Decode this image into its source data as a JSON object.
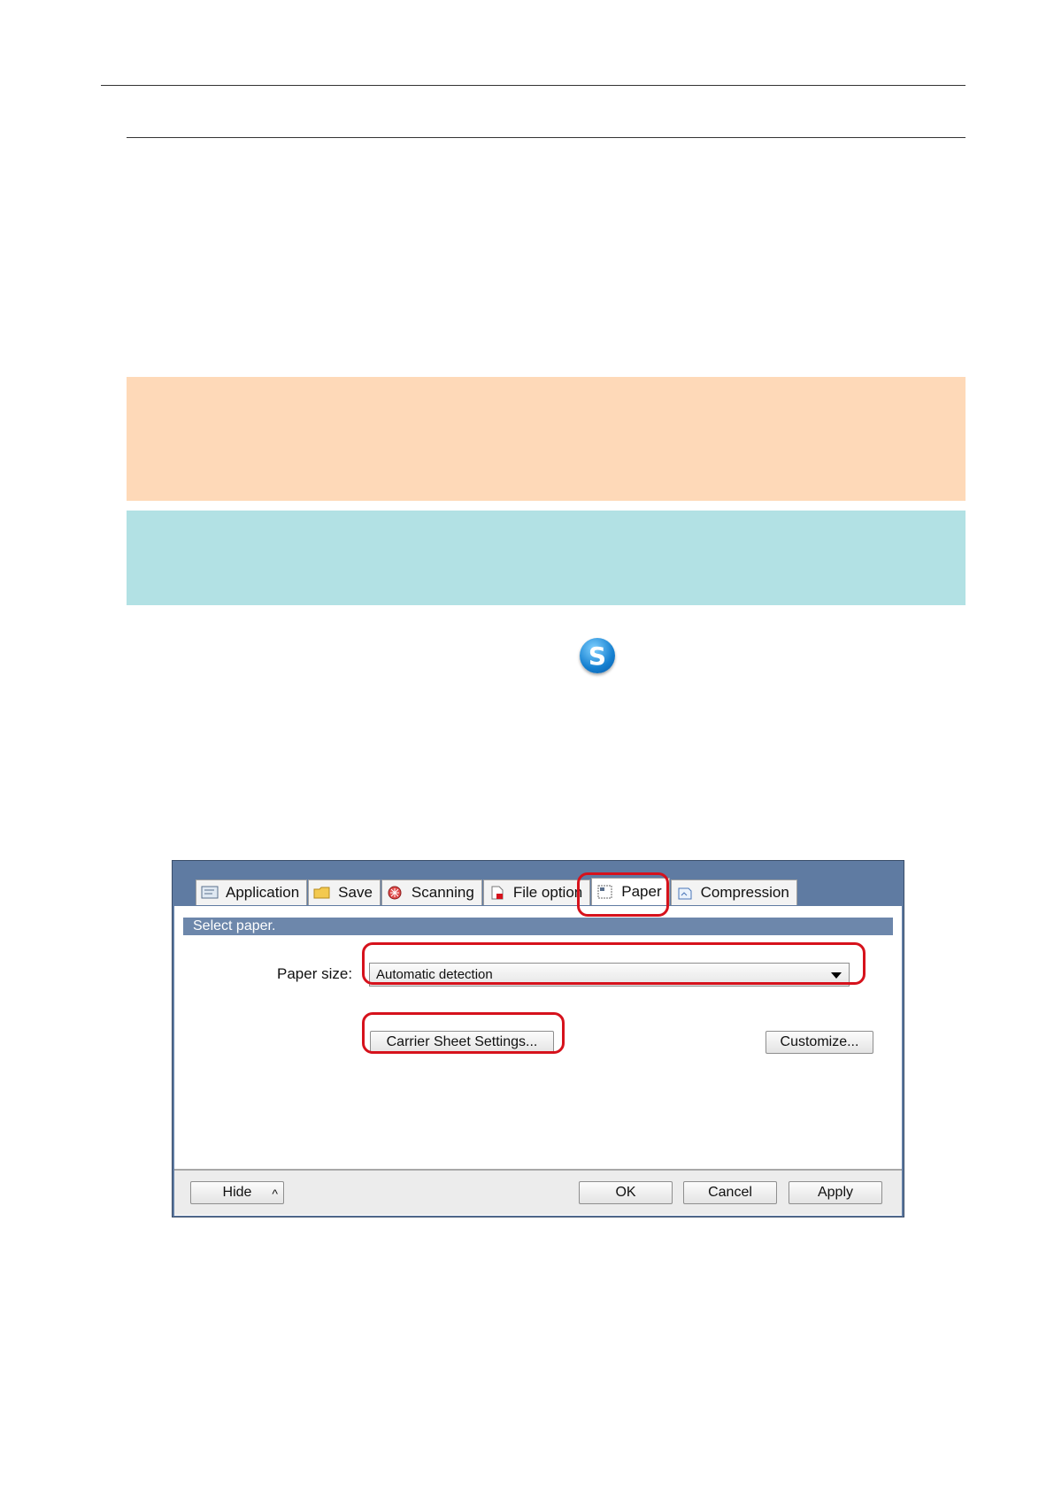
{
  "colors": {
    "caution_box": "#fed9b8",
    "hint_box": "#b2e1e4",
    "highlight": "#d6121c",
    "dialog_frame": "#5f7ba2"
  },
  "logo": {
    "icon": "scansnap-manager-icon",
    "glyph": "S"
  },
  "dialog": {
    "tabs": [
      {
        "label": "Application",
        "icon": "application-icon"
      },
      {
        "label": "Save",
        "icon": "folder-icon"
      },
      {
        "label": "Scanning",
        "icon": "scanning-icon"
      },
      {
        "label": "File option",
        "icon": "file-option-icon"
      },
      {
        "label": "Paper",
        "icon": "paper-icon"
      },
      {
        "label": "Compression",
        "icon": "compression-icon"
      }
    ],
    "header": "Select paper.",
    "paper_size_label": "Paper size:",
    "paper_size_value": "Automatic detection",
    "carrier_button": "Carrier Sheet Settings...",
    "customize_button": "Customize...",
    "footer": {
      "hide": "Hide",
      "hide_icon": "^",
      "ok": "OK",
      "cancel": "Cancel",
      "apply": "Apply"
    }
  }
}
